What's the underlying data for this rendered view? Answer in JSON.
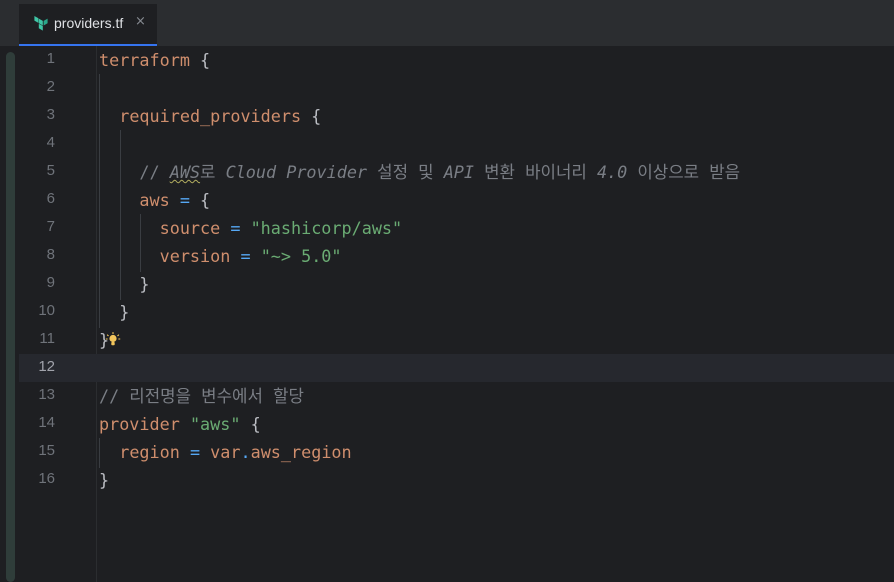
{
  "tab": {
    "filename": "providers.tf",
    "close": "×",
    "icon": "terraform-icon"
  },
  "lines": [
    {
      "n": "1",
      "tokens": [
        {
          "t": "terraform",
          "c": "k"
        },
        {
          "t": " {",
          "c": "p"
        }
      ]
    },
    {
      "n": "2",
      "tokens": []
    },
    {
      "n": "3",
      "tokens": [
        {
          "t": "  ",
          "c": "p"
        },
        {
          "t": "required_providers",
          "c": "k"
        },
        {
          "t": " {",
          "c": "p"
        }
      ]
    },
    {
      "n": "4",
      "tokens": []
    },
    {
      "n": "5",
      "tokens": [
        {
          "t": "    // ",
          "c": "cm"
        },
        {
          "t": "AWS",
          "c": "cmi squig"
        },
        {
          "t": "로 ",
          "c": "cm"
        },
        {
          "t": "Cloud Provider",
          "c": "cmi"
        },
        {
          "t": " 설정 및 ",
          "c": "cm"
        },
        {
          "t": "API",
          "c": "cmi"
        },
        {
          "t": " 변환 바이너리 ",
          "c": "cm"
        },
        {
          "t": "4.0",
          "c": "cmi"
        },
        {
          "t": " 이상으로 받음",
          "c": "cm"
        }
      ]
    },
    {
      "n": "6",
      "tokens": [
        {
          "t": "    ",
          "c": "p"
        },
        {
          "t": "aws",
          "c": "k"
        },
        {
          "t": " ",
          "c": "p"
        },
        {
          "t": "=",
          "c": "op"
        },
        {
          "t": " {",
          "c": "p"
        }
      ]
    },
    {
      "n": "7",
      "tokens": [
        {
          "t": "      ",
          "c": "p"
        },
        {
          "t": "source",
          "c": "k"
        },
        {
          "t": " ",
          "c": "p"
        },
        {
          "t": "=",
          "c": "op"
        },
        {
          "t": " ",
          "c": "p"
        },
        {
          "t": "\"hashicorp/aws\"",
          "c": "str"
        }
      ]
    },
    {
      "n": "8",
      "tokens": [
        {
          "t": "      ",
          "c": "p"
        },
        {
          "t": "version",
          "c": "k"
        },
        {
          "t": " ",
          "c": "p"
        },
        {
          "t": "=",
          "c": "op"
        },
        {
          "t": " ",
          "c": "p"
        },
        {
          "t": "\"~> 5.0\"",
          "c": "str"
        }
      ]
    },
    {
      "n": "9",
      "tokens": [
        {
          "t": "    }",
          "c": "p"
        }
      ]
    },
    {
      "n": "10",
      "tokens": [
        {
          "t": "  }",
          "c": "p"
        }
      ]
    },
    {
      "n": "11",
      "tokens": [
        {
          "t": "}",
          "c": "p"
        }
      ]
    },
    {
      "n": "12",
      "tokens": []
    },
    {
      "n": "13",
      "tokens": [
        {
          "t": "// 리전명을 변수에서 할당",
          "c": "cm"
        }
      ]
    },
    {
      "n": "14",
      "tokens": [
        {
          "t": "provider",
          "c": "k"
        },
        {
          "t": " ",
          "c": "p"
        },
        {
          "t": "\"aws\"",
          "c": "str"
        },
        {
          "t": " {",
          "c": "p"
        }
      ]
    },
    {
      "n": "15",
      "tokens": [
        {
          "t": "  ",
          "c": "p"
        },
        {
          "t": "region",
          "c": "k"
        },
        {
          "t": " ",
          "c": "p"
        },
        {
          "t": "=",
          "c": "op"
        },
        {
          "t": " ",
          "c": "p"
        },
        {
          "t": "var",
          "c": "k"
        },
        {
          "t": ".",
          "c": "op"
        },
        {
          "t": "aws_region",
          "c": "k"
        }
      ]
    },
    {
      "n": "16",
      "tokens": [
        {
          "t": "}",
          "c": "p"
        }
      ]
    }
  ],
  "current_line": "12",
  "colors": {
    "keyword": "#cf8e6d",
    "string": "#6aab73",
    "operator": "#56a8f5",
    "comment": "#7a7e85",
    "text": "#bcbec4",
    "accent": "#3574f0"
  },
  "intention_icon": "lightbulb-icon"
}
